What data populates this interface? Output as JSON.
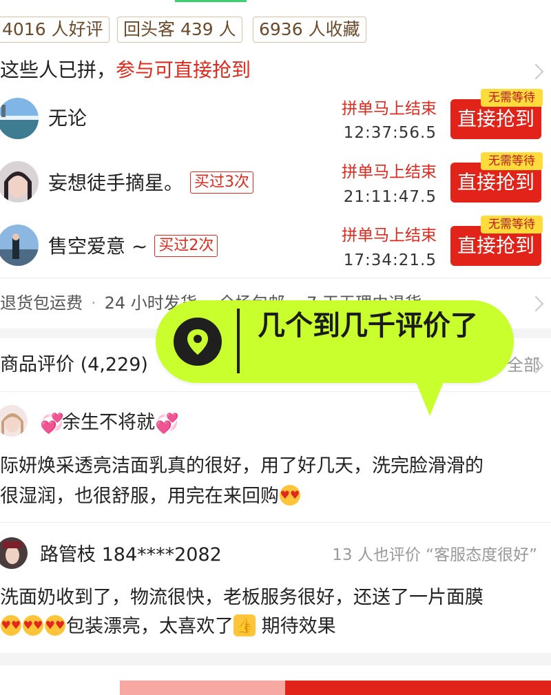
{
  "stats": {
    "good_reviews": "4016 人好评",
    "repeat_customers": "回头客 439 人",
    "favorites": "6936 人收藏"
  },
  "group": {
    "title_prefix": "这些人已拼，",
    "title_highlight": "参与可直接抢到",
    "rows": [
      {
        "name": "无论",
        "bought": "",
        "status": "拼单马上结束",
        "time": "12:37:56.5",
        "badge": "无需等待",
        "action": "直接抢到"
      },
      {
        "name": "妄想徒手摘星。",
        "bought": "买过3次",
        "status": "拼单马上结束",
        "time": "21:11:47.5",
        "badge": "无需等待",
        "action": "直接抢到"
      },
      {
        "name": "售空爱意 ~",
        "bought": "买过2次",
        "status": "拼单马上结束",
        "time": "17:34:21.5",
        "badge": "无需等待",
        "action": "直接抢到"
      }
    ]
  },
  "service": {
    "items": [
      "退货包运费",
      "24 小时发货",
      "全场包邮",
      "7 天无理由退货"
    ]
  },
  "reviews_section": {
    "title": "商品评价 (4,229)",
    "view_all": "全部"
  },
  "reviews": [
    {
      "name": "余生不将就",
      "line1": "际妍焕采透亮洁面乳真的很好，用了好几天，洗完脸滑滑的",
      "line2": "很湿润，也很舒服，用完在来回购"
    },
    {
      "name": "路管枝 184****2082",
      "hint": "13 人也评价 “客服态度很好”",
      "line1": "洗面奶收到了，物流很快，老板服务很好，还送了一片面膜",
      "line2_text": "包装漂亮，太喜欢了",
      "line2_end": "期待效果"
    }
  ],
  "overlay": {
    "text": "几个到几千评价了",
    "icon": "location-pin-icon"
  },
  "colors": {
    "accent_red": "#e2231a",
    "badge_yellow": "#ffdb3c",
    "overlay_green": "#c8ff2c",
    "tag_text": "#6b4a2a"
  }
}
